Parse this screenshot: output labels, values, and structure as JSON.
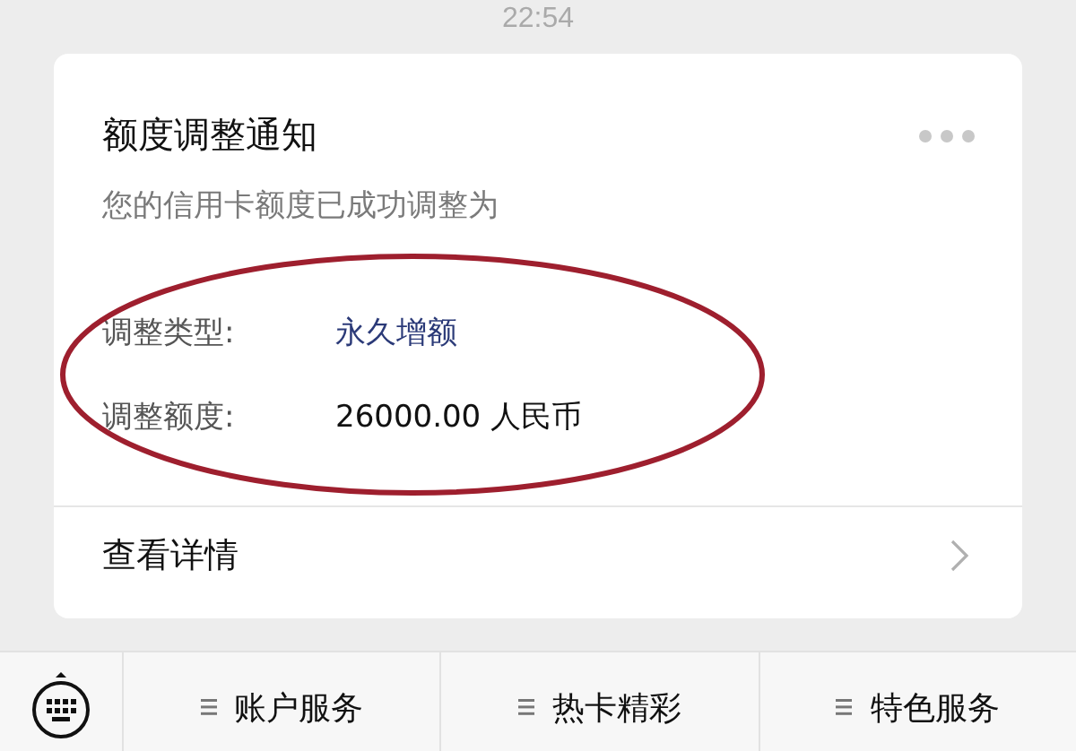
{
  "time": "22:54",
  "card": {
    "title": "额度调整通知",
    "subtitle": "您的信用卡额度已成功调整为",
    "fields": [
      {
        "label": "调整类型:",
        "value": "永久增额",
        "color": "#2b3a78"
      },
      {
        "label": "调整额度:",
        "value": "26000.00 人民币",
        "color": "#111111"
      }
    ],
    "details_link": "查看详情"
  },
  "menu": {
    "items": [
      "账户服务",
      "热卡精彩",
      "特色服务"
    ]
  }
}
